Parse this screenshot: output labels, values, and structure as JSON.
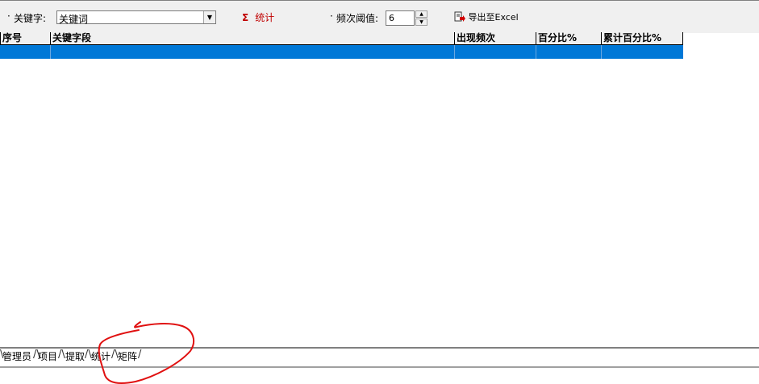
{
  "toolbar": {
    "bullet": "·",
    "keyword_label": "关键字:",
    "keyword_value": "关键词",
    "stat_icon": "Σ",
    "stat_label": "统计",
    "threshold_label": "频次阈值:",
    "threshold_value": "6",
    "export_label": "导出至Excel",
    "export_icon": "export-excel-icon"
  },
  "table": {
    "columns": [
      "序号",
      "关键字段",
      "出现频次",
      "百分比%",
      "累计百分比%"
    ],
    "selected_row_color": "#0078d7"
  },
  "tabs": [
    "管理员",
    "项目",
    "提取",
    "统计",
    "矩阵"
  ],
  "annotation": {
    "color": "#e01010"
  }
}
